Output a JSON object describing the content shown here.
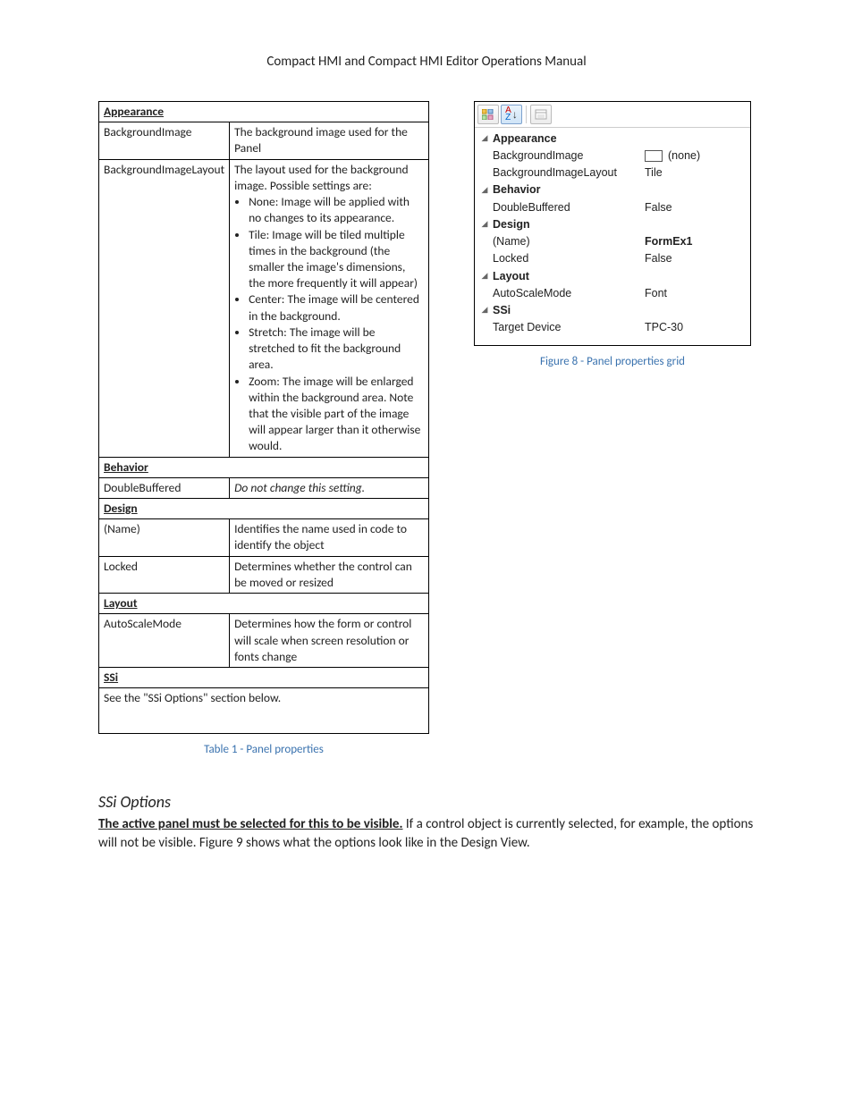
{
  "header": "Compact HMI and Compact HMI Editor Operations Manual",
  "doc_table": {
    "sections": {
      "appearance": "Appearance",
      "behavior": "Behavior",
      "design": "Design",
      "layout": "Layout",
      "ssi": "SSi"
    },
    "appearance_rows": {
      "bgimage_name": "BackgroundImage",
      "bgimage_desc": "The background image used for the Panel",
      "bgimagelayout_name": "BackgroundImageLayout",
      "bgimagelayout_intro": "The layout used for the background image. Possible settings are:",
      "bgimagelayout_items": [
        "None: Image will be applied with no changes to its appearance.",
        "Tile: Image will be tiled multiple times in the background (the smaller the image's dimensions, the more frequently it will appear)",
        "Center: The image will be centered in the background.",
        "Stretch: The image will be stretched to fit the background area.",
        "Zoom: The image will be enlarged within the background area. Note that the visible part of the image will appear larger than it otherwise would."
      ]
    },
    "behavior_rows": {
      "doublebuffered_name": "DoubleBuffered",
      "doublebuffered_desc": "Do not change this setting."
    },
    "design_rows": {
      "name_name": "(Name)",
      "name_desc": "Identifies the name used in code to identify the object",
      "locked_name": "Locked",
      "locked_desc": "Determines whether the control can be moved or resized"
    },
    "layout_rows": {
      "autoscale_name": "AutoScaleMode",
      "autoscale_desc": "Determines how the form or control will scale when screen resolution or fonts change"
    },
    "ssi_text": "See the \"SSi Options\" section below."
  },
  "table_caption": "Table 1 - Panel properties",
  "propgrid": {
    "categories": {
      "appearance": "Appearance",
      "behavior": "Behavior",
      "design": "Design",
      "layout": "Layout",
      "ssi": "SSi"
    },
    "rows": {
      "bgimage_label": "BackgroundImage",
      "bgimage_value": "(none)",
      "bgimagelayout_label": "BackgroundImageLayout",
      "bgimagelayout_value": "Tile",
      "doublebuffered_label": "DoubleBuffered",
      "doublebuffered_value": "False",
      "name_label": "(Name)",
      "name_value": "FormEx1",
      "locked_label": "Locked",
      "locked_value": "False",
      "autoscale_label": "AutoScaleMode",
      "autoscale_value": "Font",
      "target_label": "Target Device",
      "target_value": "TPC-30"
    }
  },
  "figure_caption": "Figure 8 - Panel properties grid",
  "ssi_heading": "SSi Options",
  "ssi_body_bold": "The active panel must be selected for this to be visible.",
  "ssi_body_rest": " If a control object is currently selected, for example, the options will not be visible. Figure 9 shows what the options look like in the Design View."
}
